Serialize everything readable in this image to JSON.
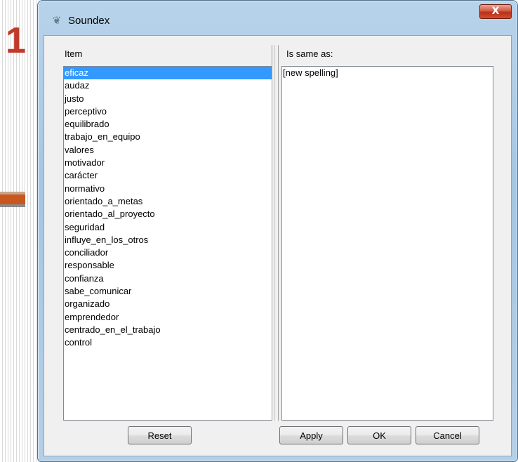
{
  "background": {
    "slide_number": "1"
  },
  "window": {
    "title": "Soundex",
    "icon": "soundex-app-icon",
    "close_glyph": "X"
  },
  "left_pane": {
    "header": "Item",
    "items": [
      {
        "label": "eficaz",
        "selected": true
      },
      {
        "label": "audaz"
      },
      {
        "label": "justo"
      },
      {
        "label": "perceptivo"
      },
      {
        "label": "equilibrado"
      },
      {
        "label": "trabajo_en_equipo"
      },
      {
        "label": "valores"
      },
      {
        "label": "motivador"
      },
      {
        "label": "carácter"
      },
      {
        "label": "normativo"
      },
      {
        "label": "orientado_a_metas"
      },
      {
        "label": "orientado_al_proyecto"
      },
      {
        "label": "seguridad"
      },
      {
        "label": "influye_en_los_otros"
      },
      {
        "label": "conciliador"
      },
      {
        "label": "responsable"
      },
      {
        "label": "confianza"
      },
      {
        "label": "sabe_comunicar"
      },
      {
        "label": "organizado"
      },
      {
        "label": "emprendedor"
      },
      {
        "label": "centrado_en_el_trabajo"
      },
      {
        "label": "control"
      }
    ]
  },
  "right_pane": {
    "header": "Is same as:",
    "items": [
      {
        "label": "[new spelling]"
      }
    ]
  },
  "buttons": {
    "reset": "Reset",
    "apply": "Apply",
    "ok": "OK",
    "cancel": "Cancel"
  },
  "colors": {
    "selection": "#3399ff",
    "slide_accent": "#c0392b",
    "close_button": "#c8432a"
  }
}
